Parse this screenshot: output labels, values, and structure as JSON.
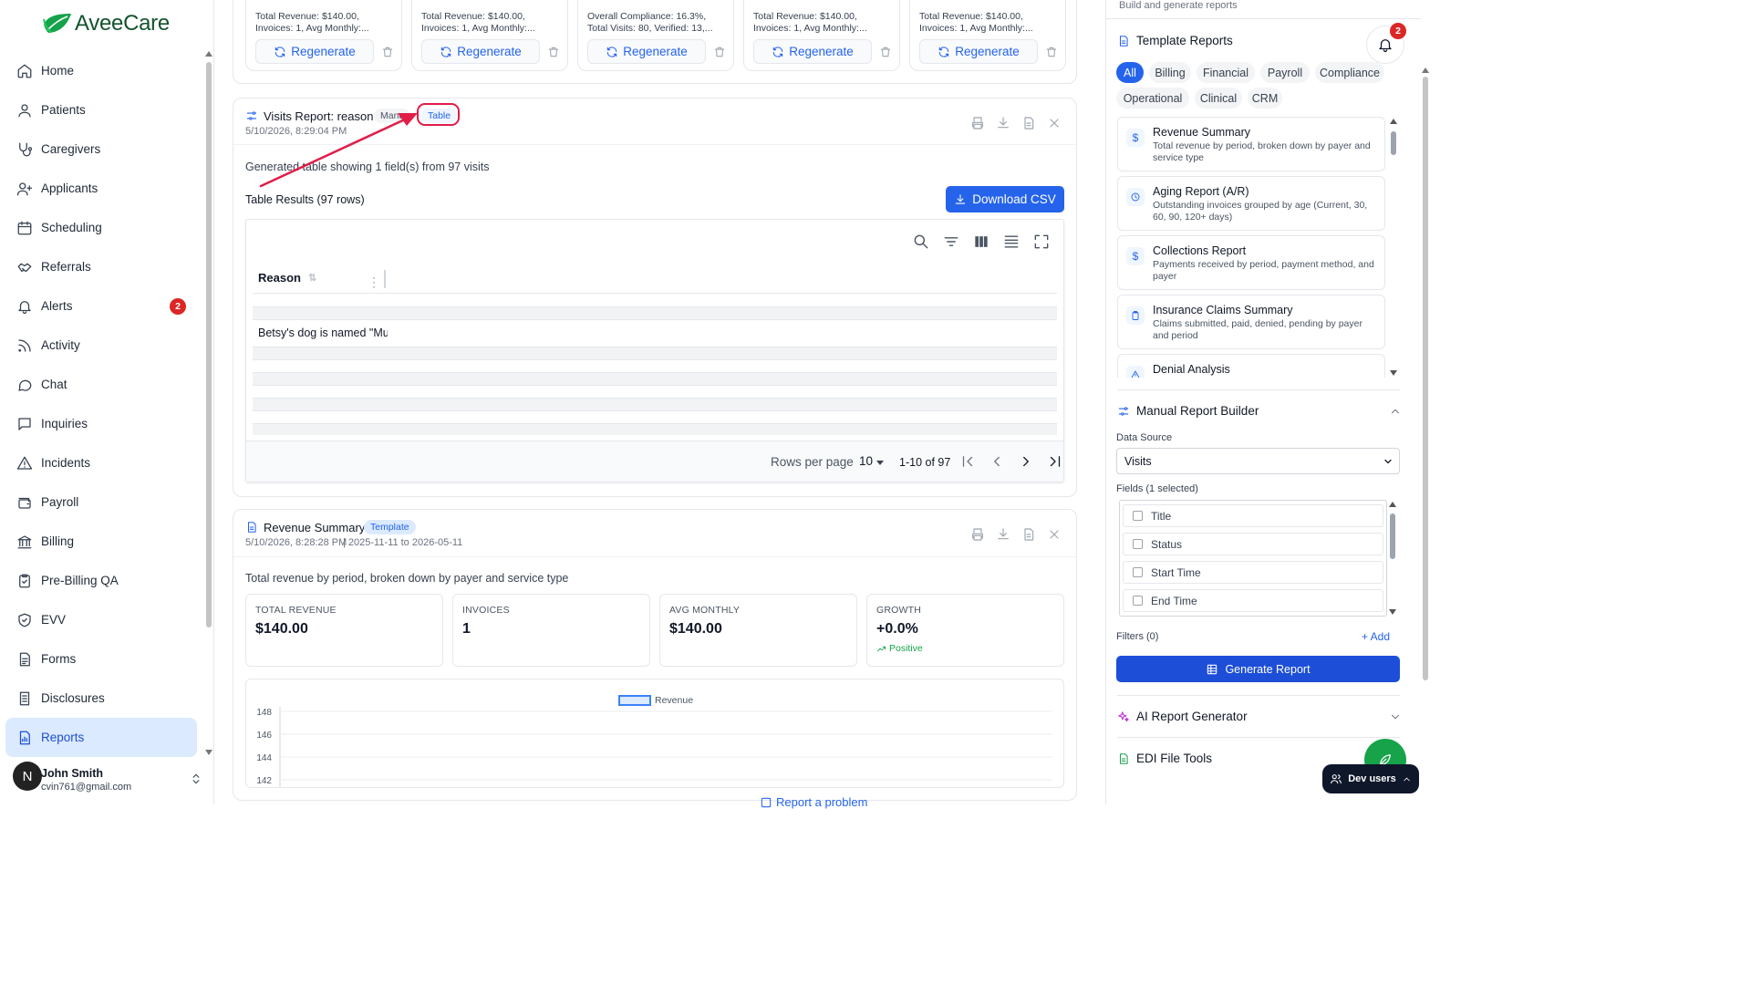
{
  "app": {
    "brand": "AveeCare"
  },
  "sidebar": {
    "items": [
      {
        "label": "Home",
        "icon": "home-icon"
      },
      {
        "label": "Patients",
        "icon": "user-icon"
      },
      {
        "label": "Caregivers",
        "icon": "stethoscope-icon"
      },
      {
        "label": "Applicants",
        "icon": "user-plus-icon"
      },
      {
        "label": "Scheduling",
        "icon": "calendar-icon"
      },
      {
        "label": "Referrals",
        "icon": "handshake-icon"
      },
      {
        "label": "Alerts",
        "icon": "bell-icon",
        "badge": "2"
      },
      {
        "label": "Activity",
        "icon": "rss-icon"
      },
      {
        "label": "Chat",
        "icon": "chat-icon"
      },
      {
        "label": "Inquiries",
        "icon": "message-square-icon"
      },
      {
        "label": "Incidents",
        "icon": "warning-icon"
      },
      {
        "label": "Payroll",
        "icon": "wallet-icon"
      },
      {
        "label": "Billing",
        "icon": "bank-icon"
      },
      {
        "label": "Pre-Billing QA",
        "icon": "clipboard-check-icon"
      },
      {
        "label": "EVV",
        "icon": "shield-check-icon"
      },
      {
        "label": "Forms",
        "icon": "file-text-icon"
      },
      {
        "label": "Disclosures",
        "icon": "file-list-icon"
      },
      {
        "label": "Reports",
        "icon": "report-icon",
        "active": true
      }
    ],
    "user": {
      "initial": "N",
      "name": "John Smith",
      "email": "cvin761@gmail.com"
    }
  },
  "top_cards": [
    {
      "line1": "Total Revenue: $140.00,",
      "line2": "Invoices: 1, Avg Monthly:...",
      "button": "Regenerate"
    },
    {
      "line1": "Total Revenue: $140.00,",
      "line2": "Invoices: 1, Avg Monthly:...",
      "button": "Regenerate"
    },
    {
      "line1": "Overall Compliance: 16.3%,",
      "line2": "Total Visits: 80, Verified: 13,...",
      "button": "Regenerate"
    },
    {
      "line1": "Total Revenue: $140.00,",
      "line2": "Invoices: 1, Avg Monthly:...",
      "button": "Regenerate"
    },
    {
      "line1": "Total Revenue: $140.00,",
      "line2": "Invoices: 1, Avg Monthly:...",
      "button": "Regenerate"
    }
  ],
  "visits_report": {
    "title": "Visits Report: reason",
    "badge_manual": "Manu",
    "badge_table": "Table",
    "timestamp": "5/10/2026, 8:29:04 PM",
    "description": "Generated table showing 1 field(s) from 97 visits",
    "results_label": "Table Results (97 rows)",
    "download_label": "Download CSV",
    "column_header": "Reason",
    "cell": "Betsy's dog is named \"Mu",
    "rows_per_page_label": "Rows per page",
    "rows_per_page": "10",
    "range": "1-10 of 97"
  },
  "revenue_summary": {
    "title": "Revenue Summary",
    "badge": "Template",
    "timestamp": "5/10/2026, 8:28:28 PM",
    "range": "2025-11-11 to 2026-05-11",
    "description": "Total revenue by period, broken down by payer and service type",
    "stats": [
      {
        "label": "TOTAL REVENUE",
        "value": "$140.00"
      },
      {
        "label": "INVOICES",
        "value": "1"
      },
      {
        "label": "AVG MONTHLY",
        "value": "$140.00"
      },
      {
        "label": "GROWTH",
        "value": "+0.0%",
        "note": "Positive"
      }
    ]
  },
  "chart_data": {
    "type": "bar",
    "series": [
      {
        "name": "Revenue",
        "values": []
      }
    ],
    "ytick_labels": [
      "148",
      "146",
      "144",
      "142"
    ],
    "ylim": [
      142,
      148
    ],
    "legend": "top-center",
    "grid": true,
    "color": "#3b82f6"
  },
  "footer": {
    "report_problem": "Report a problem"
  },
  "right_panel": {
    "subtitle": "Build and generate reports",
    "notification_count": "2",
    "templates": {
      "title": "Template Reports",
      "chips": [
        "All",
        "Billing",
        "Financial",
        "Payroll",
        "Compliance",
        "Operational",
        "Clinical",
        "CRM"
      ],
      "items": [
        {
          "name": "Revenue Summary",
          "desc": "Total revenue by period, broken down by payer and service type",
          "icon": "$"
        },
        {
          "name": "Aging Report (A/R)",
          "desc": "Outstanding invoices grouped by age (Current, 30, 60, 90, 120+ days)",
          "icon": "clock-icon"
        },
        {
          "name": "Collections Report",
          "desc": "Payments received by period, payment method, and payer",
          "icon": "$"
        },
        {
          "name": "Insurance Claims Summary",
          "desc": "Claims submitted, paid, denied, pending by payer and period",
          "icon": "clipboard-icon"
        },
        {
          "name": "Denial Analysis",
          "desc": "",
          "icon": "warning-icon"
        }
      ]
    },
    "manual_builder": {
      "title": "Manual Report Builder",
      "data_source_label": "Data Source",
      "data_source_value": "Visits",
      "fields_label": "Fields (1 selected)",
      "fields": [
        "Title",
        "Status",
        "Start Time",
        "End Time"
      ],
      "filters_label": "Filters (0)",
      "add_label": "+ Add",
      "generate_label": "Generate Report"
    },
    "ai_generator": {
      "title": "AI Report Generator"
    },
    "edi": {
      "title": "EDI File Tools"
    },
    "dev_users": "Dev users"
  },
  "colors": {
    "primary": "#2563eb",
    "brand_green": "#16a34a",
    "alert": "#dc2626",
    "annotation": "#e11d48"
  }
}
